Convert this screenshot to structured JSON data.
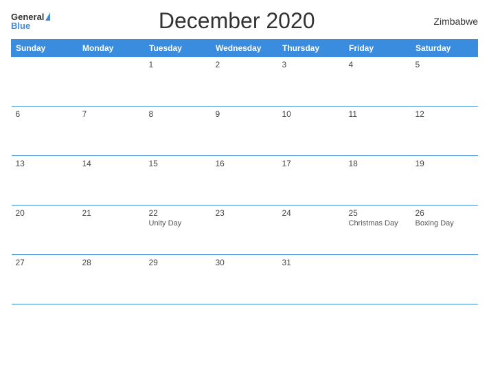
{
  "header": {
    "logo_general": "General",
    "logo_blue": "Blue",
    "title": "December 2020",
    "country": "Zimbabwe"
  },
  "weekdays": [
    "Sunday",
    "Monday",
    "Tuesday",
    "Wednesday",
    "Thursday",
    "Friday",
    "Saturday"
  ],
  "weeks": [
    [
      {
        "day": "",
        "holiday": ""
      },
      {
        "day": "",
        "holiday": ""
      },
      {
        "day": "1",
        "holiday": ""
      },
      {
        "day": "2",
        "holiday": ""
      },
      {
        "day": "3",
        "holiday": ""
      },
      {
        "day": "4",
        "holiday": ""
      },
      {
        "day": "5",
        "holiday": ""
      }
    ],
    [
      {
        "day": "6",
        "holiday": ""
      },
      {
        "day": "7",
        "holiday": ""
      },
      {
        "day": "8",
        "holiday": ""
      },
      {
        "day": "9",
        "holiday": ""
      },
      {
        "day": "10",
        "holiday": ""
      },
      {
        "day": "11",
        "holiday": ""
      },
      {
        "day": "12",
        "holiday": ""
      }
    ],
    [
      {
        "day": "13",
        "holiday": ""
      },
      {
        "day": "14",
        "holiday": ""
      },
      {
        "day": "15",
        "holiday": ""
      },
      {
        "day": "16",
        "holiday": ""
      },
      {
        "day": "17",
        "holiday": ""
      },
      {
        "day": "18",
        "holiday": ""
      },
      {
        "day": "19",
        "holiday": ""
      }
    ],
    [
      {
        "day": "20",
        "holiday": ""
      },
      {
        "day": "21",
        "holiday": ""
      },
      {
        "day": "22",
        "holiday": "Unity Day"
      },
      {
        "day": "23",
        "holiday": ""
      },
      {
        "day": "24",
        "holiday": ""
      },
      {
        "day": "25",
        "holiday": "Christmas Day"
      },
      {
        "day": "26",
        "holiday": "Boxing Day"
      }
    ],
    [
      {
        "day": "27",
        "holiday": ""
      },
      {
        "day": "28",
        "holiday": ""
      },
      {
        "day": "29",
        "holiday": ""
      },
      {
        "day": "30",
        "holiday": ""
      },
      {
        "day": "31",
        "holiday": ""
      },
      {
        "day": "",
        "holiday": ""
      },
      {
        "day": "",
        "holiday": ""
      }
    ]
  ]
}
